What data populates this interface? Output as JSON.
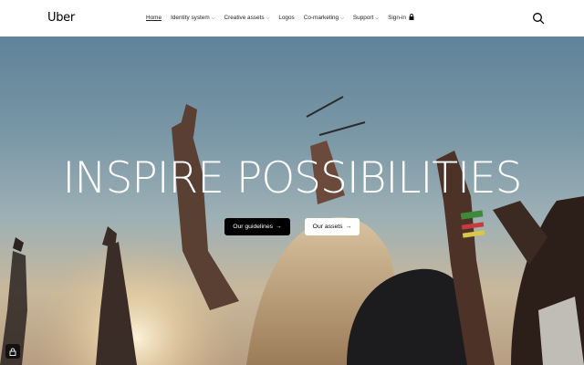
{
  "header": {
    "logo": "Uber",
    "nav": [
      {
        "label": "Home",
        "dropdown": false,
        "active": true
      },
      {
        "label": "Identity system",
        "dropdown": true,
        "active": false
      },
      {
        "label": "Creative assets",
        "dropdown": true,
        "active": false
      },
      {
        "label": "Logos",
        "dropdown": false,
        "active": false
      },
      {
        "label": "Co-marketing",
        "dropdown": true,
        "active": false
      },
      {
        "label": "Support",
        "dropdown": true,
        "active": false
      },
      {
        "label": "Sign-in",
        "dropdown": false,
        "active": false,
        "icon": "lock-icon"
      }
    ],
    "search_icon": "search-icon"
  },
  "hero": {
    "headline": "INSPIRE POSSIBILITIES",
    "buttons": {
      "guidelines": "Our guidelines",
      "assets": "Our assets"
    },
    "arrow": "→"
  },
  "colors": {
    "header_bg": "#ffffff",
    "primary_button": "#000000",
    "secondary_button": "#ffffff",
    "headline": "#ffffff"
  }
}
